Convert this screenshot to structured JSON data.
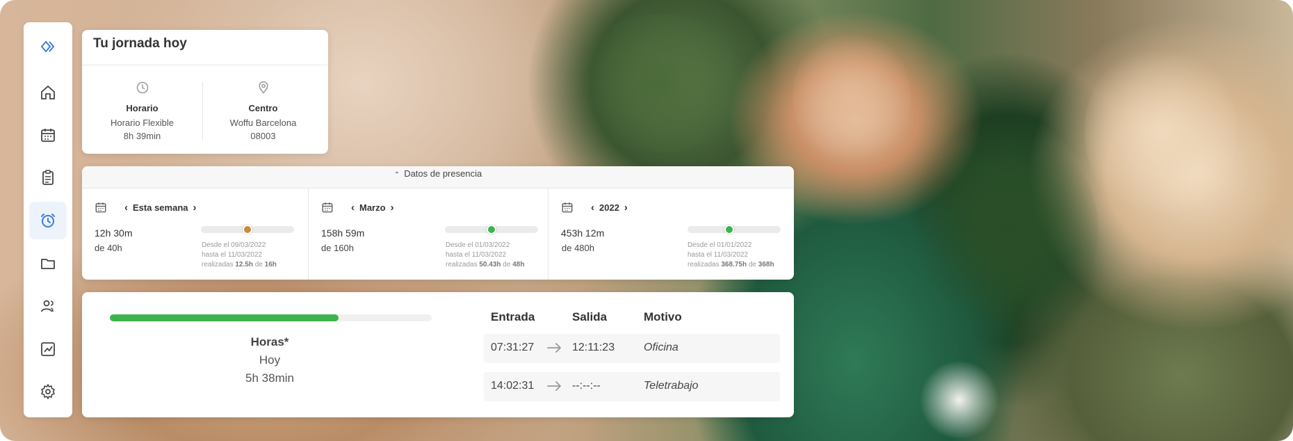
{
  "sidebar": {
    "items": [
      {
        "icon": "logo-icon",
        "active": false
      },
      {
        "icon": "home-icon",
        "active": false
      },
      {
        "icon": "calendar-icon",
        "active": false
      },
      {
        "icon": "clipboard-icon",
        "active": false
      },
      {
        "icon": "alarm-clock-icon",
        "active": true
      },
      {
        "icon": "folder-icon",
        "active": false
      },
      {
        "icon": "users-icon",
        "active": false
      },
      {
        "icon": "chart-icon",
        "active": false
      },
      {
        "icon": "gear-icon",
        "active": false
      }
    ],
    "accent": "#3b7ddd"
  },
  "jornada": {
    "title": "Tu jornada hoy",
    "horario": {
      "label": "Horario",
      "line1": "Horario Flexible",
      "line2": "8h 39min"
    },
    "centro": {
      "label": "Centro",
      "line1": "Woffu Barcelona",
      "line2": "08003"
    }
  },
  "presencia": {
    "header": "Datos de presencia",
    "periods": [
      {
        "label": "Esta semana",
        "hours": "12h 30m",
        "of": "de 40h",
        "desde": "Desde el 09/03/2022",
        "hasta": "hasta el 11/03/2022",
        "realizadas_prefix": "realizadas",
        "realizadas_value": "12.5h",
        "realizadas_mid": "de",
        "realizadas_total": "16h",
        "progress": 0.5,
        "dot_color": "#c98a3a"
      },
      {
        "label": "Marzo",
        "hours": "158h 59m",
        "of": "de 160h",
        "desde": "Desde el 01/03/2022",
        "hasta": "hasta el 11/03/2022",
        "realizadas_prefix": "realizadas",
        "realizadas_value": "50.43h",
        "realizadas_mid": "de",
        "realizadas_total": "48h",
        "progress": 0.5,
        "dot_color": "#3cb44b"
      },
      {
        "label": "2022",
        "hours": "453h 12m",
        "of": "de 480h",
        "desde": "Desde el 01/01/2022",
        "hasta": "hasta el 11/03/2022",
        "realizadas_prefix": "realizadas",
        "realizadas_value": "368.75h",
        "realizadas_mid": "de",
        "realizadas_total": "368h",
        "progress": 0.45,
        "dot_color": "#3cb44b"
      }
    ]
  },
  "fichaje": {
    "progress": 0.71,
    "progress_color": "#3cb44b",
    "hours_label": "Horas*",
    "today_label": "Hoy",
    "today_value": "5h 38min",
    "headers": {
      "entrada": "Entrada",
      "salida": "Salida",
      "motivo": "Motivo"
    },
    "rows": [
      {
        "entrada": "07:31:27",
        "salida": "12:11:23",
        "motivo": "Oficina"
      },
      {
        "entrada": "14:02:31",
        "salida": "--:--:--",
        "motivo": "Teletrabajo"
      }
    ]
  }
}
